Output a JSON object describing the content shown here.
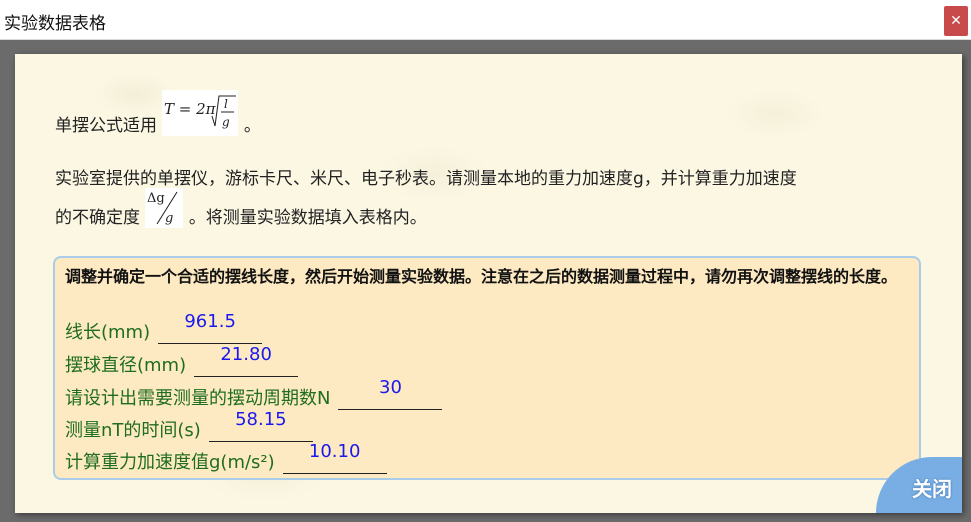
{
  "window": {
    "title": "实验数据表格",
    "close_glyph": "✕"
  },
  "intro": {
    "line1_prefix": "单摆公式适用",
    "line1_suffix": "。",
    "line2": "实验室提供的单摆仪，游标卡尺、米尺、电子秒表。请测量本地的重力加速度g，并计算重力加速度",
    "line3_prefix": "的不确定度",
    "line3_suffix": "。将测量实验数据填入表格内。"
  },
  "formula": {
    "lhs": "T = 2π",
    "num": "l",
    "den": "g"
  },
  "uncertainty": {
    "num": "Δg",
    "den": "g"
  },
  "instruction": "调整并确定一个合适的摆线长度，然后开始测量实验数据。注意在之后的数据测量过程中，请勿再次调整摆线的长度。",
  "fields": [
    {
      "label": "线长(mm)",
      "value": "961.5"
    },
    {
      "label": "摆球直径(mm)",
      "value": "21.80"
    },
    {
      "label": "请设计出需要测量的摆动周期数N",
      "value": "30"
    },
    {
      "label": "测量nT的时间(s)",
      "value": "58.15"
    },
    {
      "label": "计算重力加速度值g(m/s²)",
      "value": "10.10"
    }
  ],
  "close_button": "关闭"
}
